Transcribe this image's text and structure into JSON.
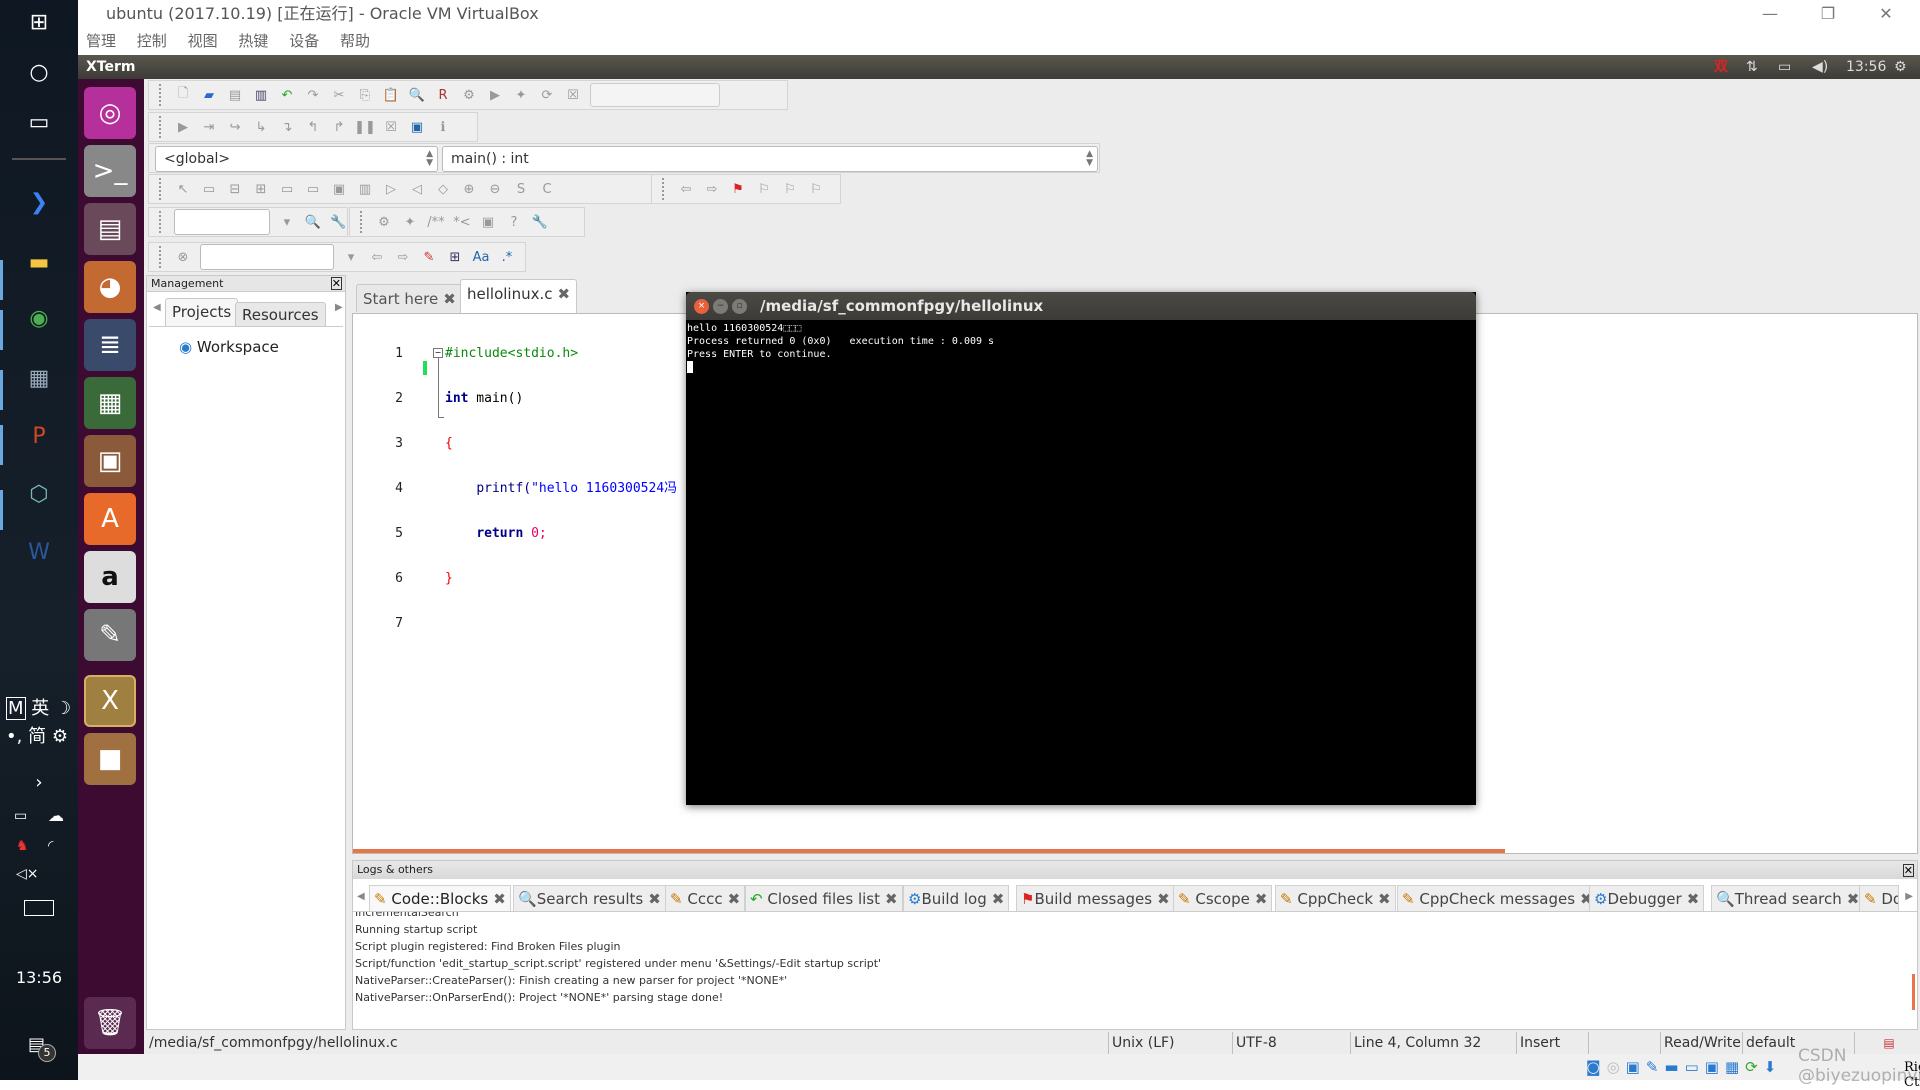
{
  "window": {
    "title": "ubuntu (2017.10.19) [正在运行] - Oracle VM VirtualBox",
    "controls": [
      "minimize",
      "restore",
      "close"
    ]
  },
  "vbox_menu": [
    "管理",
    "控制",
    "视图",
    "热键",
    "设备",
    "帮助"
  ],
  "ubuntu_panel": {
    "app_name": "XTerm",
    "input_method": "双",
    "clock": "13:56"
  },
  "windows_taskbar": {
    "ime": {
      "mode": "M",
      "lang": "英",
      "moon": "☽",
      "punct": "•,",
      "script": "简"
    },
    "clock": "13:56",
    "notifications": "5"
  },
  "launcher": {
    "tooltip": "XTerm"
  },
  "toolbar": {
    "scope": "<global>",
    "function": "main() : int"
  },
  "management": {
    "title": "Management",
    "tabs": [
      "Projects",
      "Resources"
    ],
    "tree_root": "Workspace"
  },
  "editor": {
    "tabs": [
      {
        "label": "Start here",
        "active": false
      },
      {
        "label": "hellolinux.c",
        "active": true
      }
    ],
    "line_numbers": [
      "1",
      "2",
      "3",
      "4",
      "5",
      "6",
      "7"
    ],
    "lines": {
      "l1": "#include<stdio.h>",
      "l2_kw": "int",
      "l2_rest": " main()",
      "l3": "{",
      "l4_fn": "printf(",
      "l4_str": "\"hello 1160300524冯",
      "l5_kw": "return",
      "l5_num": " 0;",
      "l6": "}"
    }
  },
  "terminal": {
    "title": "/media/sf_commonfpgy/hellolinux",
    "lines": [
      "hello 1160300524⬚⬚⬚",
      "",
      "Process returned 0 (0x0)   execution time : 0.009 s",
      "Press ENTER to continue."
    ]
  },
  "logs": {
    "title": "Logs & others",
    "tabs": [
      "Code::Blocks",
      "Search results",
      "Cccc",
      "Closed files list",
      "Build log",
      "Build messages",
      "Cscope",
      "CppCheck",
      "CppCheck messages",
      "Debugger",
      "Thread search",
      "Do"
    ],
    "lines": [
      "IncrementalSearch",
      "Running startup script",
      "Script plugin registered: Find Broken Files plugin",
      "Script/function 'edit_startup_script.script' registered under menu '&Settings/-Edit startup script'",
      "NativeParser::CreateParser(): Finish creating a new parser for project '*NONE*'",
      "NativeParser::OnParserEnd(): Project '*NONE*' parsing stage done!"
    ]
  },
  "statusbar": {
    "path": "/media/sf_commonfpgy/hellolinux.c",
    "eol": "Unix (LF)",
    "encoding": "UTF-8",
    "position": "Line 4, Column 32",
    "mode": "Insert",
    "access": "Read/Write",
    "theme": "default"
  },
  "vbox_status": {
    "host_key": "Right Ctrl",
    "watermark": "CSDN @biyezuopinvip"
  }
}
